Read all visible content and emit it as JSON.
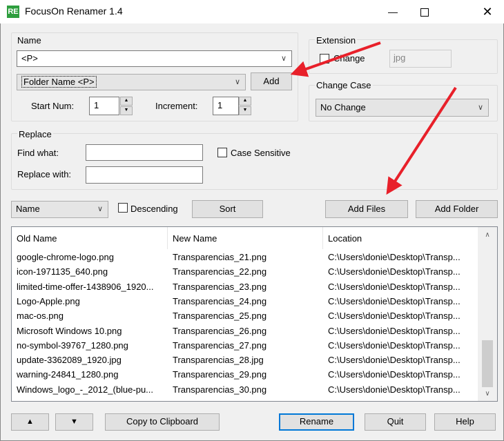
{
  "window": {
    "title": "FocusOn Renamer 1.4",
    "icon_text": "RE"
  },
  "name_group": {
    "label": "Name",
    "pattern": "<P>",
    "token_select": "Folder Name <P>",
    "add_label": "Add",
    "start_num_label": "Start Num:",
    "start_num": "1",
    "increment_label": "Increment:",
    "increment": "1"
  },
  "extension_group": {
    "label": "Extension",
    "change_label": "Change",
    "value": "jpg"
  },
  "case_group": {
    "label": "Change Case",
    "value": "No Change"
  },
  "replace_group": {
    "label": "Replace",
    "find_label": "Find what:",
    "replace_label": "Replace with:",
    "case_sensitive_label": "Case Sensitive"
  },
  "sort_bar": {
    "sort_by": "Name",
    "descending_label": "Descending",
    "sort_label": "Sort",
    "add_files_label": "Add Files",
    "add_folder_label": "Add Folder"
  },
  "table": {
    "columns": [
      "Old Name",
      "New Name",
      "Location"
    ],
    "rows": [
      [
        "google-chrome-logo.png",
        "Transparencias_21.png",
        "C:\\Users\\donie\\Desktop\\Transp..."
      ],
      [
        "icon-1971135_640.png",
        "Transparencias_22.png",
        "C:\\Users\\donie\\Desktop\\Transp..."
      ],
      [
        "limited-time-offer-1438906_1920...",
        "Transparencias_23.png",
        "C:\\Users\\donie\\Desktop\\Transp..."
      ],
      [
        "Logo-Apple.png",
        "Transparencias_24.png",
        "C:\\Users\\donie\\Desktop\\Transp..."
      ],
      [
        "mac-os.png",
        "Transparencias_25.png",
        "C:\\Users\\donie\\Desktop\\Transp..."
      ],
      [
        "Microsoft Windows 10.png",
        "Transparencias_26.png",
        "C:\\Users\\donie\\Desktop\\Transp..."
      ],
      [
        "no-symbol-39767_1280.png",
        "Transparencias_27.png",
        "C:\\Users\\donie\\Desktop\\Transp..."
      ],
      [
        "update-3362089_1920.jpg",
        "Transparencias_28.jpg",
        "C:\\Users\\donie\\Desktop\\Transp..."
      ],
      [
        "warning-24841_1280.png",
        "Transparencias_29.png",
        "C:\\Users\\donie\\Desktop\\Transp..."
      ],
      [
        "Windows_logo_-_2012_(blue-pu...",
        "Transparencias_30.png",
        "C:\\Users\\donie\\Desktop\\Transp..."
      ]
    ]
  },
  "bottom_bar": {
    "up_glyph": "▲",
    "down_glyph": "▼",
    "copy_label": "Copy to Clipboard",
    "rename_label": "Rename",
    "quit_label": "Quit",
    "help_label": "Help"
  },
  "colors": {
    "accent": "#0078d7",
    "annotation_arrow": "#e8202a",
    "app_icon": "#2e9e3e"
  },
  "icons": [
    "minimize-icon",
    "maximize-icon",
    "close-icon",
    "chevron-down-icon",
    "spin-up-icon",
    "spin-down-icon",
    "scroll-up-icon",
    "scroll-down-icon",
    "annotation-arrow-icon"
  ]
}
